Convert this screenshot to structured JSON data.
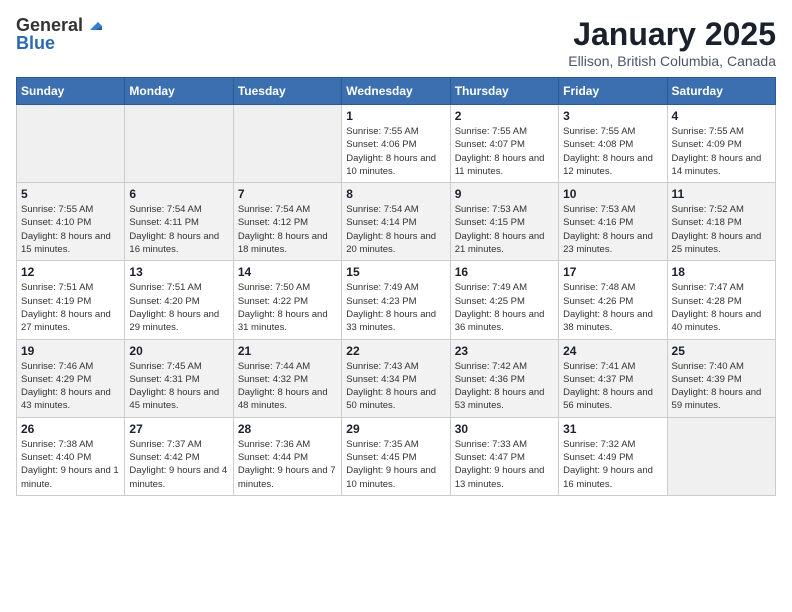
{
  "app": {
    "logo_general": "General",
    "logo_blue": "Blue"
  },
  "header": {
    "month": "January 2025",
    "location": "Ellison, British Columbia, Canada"
  },
  "weekdays": [
    "Sunday",
    "Monday",
    "Tuesday",
    "Wednesday",
    "Thursday",
    "Friday",
    "Saturday"
  ],
  "weeks": [
    [
      {
        "day": "",
        "sunrise": "",
        "sunset": "",
        "daylight": ""
      },
      {
        "day": "",
        "sunrise": "",
        "sunset": "",
        "daylight": ""
      },
      {
        "day": "",
        "sunrise": "",
        "sunset": "",
        "daylight": ""
      },
      {
        "day": "1",
        "sunrise": "Sunrise: 7:55 AM",
        "sunset": "Sunset: 4:06 PM",
        "daylight": "Daylight: 8 hours and 10 minutes."
      },
      {
        "day": "2",
        "sunrise": "Sunrise: 7:55 AM",
        "sunset": "Sunset: 4:07 PM",
        "daylight": "Daylight: 8 hours and 11 minutes."
      },
      {
        "day": "3",
        "sunrise": "Sunrise: 7:55 AM",
        "sunset": "Sunset: 4:08 PM",
        "daylight": "Daylight: 8 hours and 12 minutes."
      },
      {
        "day": "4",
        "sunrise": "Sunrise: 7:55 AM",
        "sunset": "Sunset: 4:09 PM",
        "daylight": "Daylight: 8 hours and 14 minutes."
      }
    ],
    [
      {
        "day": "5",
        "sunrise": "Sunrise: 7:55 AM",
        "sunset": "Sunset: 4:10 PM",
        "daylight": "Daylight: 8 hours and 15 minutes."
      },
      {
        "day": "6",
        "sunrise": "Sunrise: 7:54 AM",
        "sunset": "Sunset: 4:11 PM",
        "daylight": "Daylight: 8 hours and 16 minutes."
      },
      {
        "day": "7",
        "sunrise": "Sunrise: 7:54 AM",
        "sunset": "Sunset: 4:12 PM",
        "daylight": "Daylight: 8 hours and 18 minutes."
      },
      {
        "day": "8",
        "sunrise": "Sunrise: 7:54 AM",
        "sunset": "Sunset: 4:14 PM",
        "daylight": "Daylight: 8 hours and 20 minutes."
      },
      {
        "day": "9",
        "sunrise": "Sunrise: 7:53 AM",
        "sunset": "Sunset: 4:15 PM",
        "daylight": "Daylight: 8 hours and 21 minutes."
      },
      {
        "day": "10",
        "sunrise": "Sunrise: 7:53 AM",
        "sunset": "Sunset: 4:16 PM",
        "daylight": "Daylight: 8 hours and 23 minutes."
      },
      {
        "day": "11",
        "sunrise": "Sunrise: 7:52 AM",
        "sunset": "Sunset: 4:18 PM",
        "daylight": "Daylight: 8 hours and 25 minutes."
      }
    ],
    [
      {
        "day": "12",
        "sunrise": "Sunrise: 7:51 AM",
        "sunset": "Sunset: 4:19 PM",
        "daylight": "Daylight: 8 hours and 27 minutes."
      },
      {
        "day": "13",
        "sunrise": "Sunrise: 7:51 AM",
        "sunset": "Sunset: 4:20 PM",
        "daylight": "Daylight: 8 hours and 29 minutes."
      },
      {
        "day": "14",
        "sunrise": "Sunrise: 7:50 AM",
        "sunset": "Sunset: 4:22 PM",
        "daylight": "Daylight: 8 hours and 31 minutes."
      },
      {
        "day": "15",
        "sunrise": "Sunrise: 7:49 AM",
        "sunset": "Sunset: 4:23 PM",
        "daylight": "Daylight: 8 hours and 33 minutes."
      },
      {
        "day": "16",
        "sunrise": "Sunrise: 7:49 AM",
        "sunset": "Sunset: 4:25 PM",
        "daylight": "Daylight: 8 hours and 36 minutes."
      },
      {
        "day": "17",
        "sunrise": "Sunrise: 7:48 AM",
        "sunset": "Sunset: 4:26 PM",
        "daylight": "Daylight: 8 hours and 38 minutes."
      },
      {
        "day": "18",
        "sunrise": "Sunrise: 7:47 AM",
        "sunset": "Sunset: 4:28 PM",
        "daylight": "Daylight: 8 hours and 40 minutes."
      }
    ],
    [
      {
        "day": "19",
        "sunrise": "Sunrise: 7:46 AM",
        "sunset": "Sunset: 4:29 PM",
        "daylight": "Daylight: 8 hours and 43 minutes."
      },
      {
        "day": "20",
        "sunrise": "Sunrise: 7:45 AM",
        "sunset": "Sunset: 4:31 PM",
        "daylight": "Daylight: 8 hours and 45 minutes."
      },
      {
        "day": "21",
        "sunrise": "Sunrise: 7:44 AM",
        "sunset": "Sunset: 4:32 PM",
        "daylight": "Daylight: 8 hours and 48 minutes."
      },
      {
        "day": "22",
        "sunrise": "Sunrise: 7:43 AM",
        "sunset": "Sunset: 4:34 PM",
        "daylight": "Daylight: 8 hours and 50 minutes."
      },
      {
        "day": "23",
        "sunrise": "Sunrise: 7:42 AM",
        "sunset": "Sunset: 4:36 PM",
        "daylight": "Daylight: 8 hours and 53 minutes."
      },
      {
        "day": "24",
        "sunrise": "Sunrise: 7:41 AM",
        "sunset": "Sunset: 4:37 PM",
        "daylight": "Daylight: 8 hours and 56 minutes."
      },
      {
        "day": "25",
        "sunrise": "Sunrise: 7:40 AM",
        "sunset": "Sunset: 4:39 PM",
        "daylight": "Daylight: 8 hours and 59 minutes."
      }
    ],
    [
      {
        "day": "26",
        "sunrise": "Sunrise: 7:38 AM",
        "sunset": "Sunset: 4:40 PM",
        "daylight": "Daylight: 9 hours and 1 minute."
      },
      {
        "day": "27",
        "sunrise": "Sunrise: 7:37 AM",
        "sunset": "Sunset: 4:42 PM",
        "daylight": "Daylight: 9 hours and 4 minutes."
      },
      {
        "day": "28",
        "sunrise": "Sunrise: 7:36 AM",
        "sunset": "Sunset: 4:44 PM",
        "daylight": "Daylight: 9 hours and 7 minutes."
      },
      {
        "day": "29",
        "sunrise": "Sunrise: 7:35 AM",
        "sunset": "Sunset: 4:45 PM",
        "daylight": "Daylight: 9 hours and 10 minutes."
      },
      {
        "day": "30",
        "sunrise": "Sunrise: 7:33 AM",
        "sunset": "Sunset: 4:47 PM",
        "daylight": "Daylight: 9 hours and 13 minutes."
      },
      {
        "day": "31",
        "sunrise": "Sunrise: 7:32 AM",
        "sunset": "Sunset: 4:49 PM",
        "daylight": "Daylight: 9 hours and 16 minutes."
      },
      {
        "day": "",
        "sunrise": "",
        "sunset": "",
        "daylight": ""
      }
    ]
  ]
}
